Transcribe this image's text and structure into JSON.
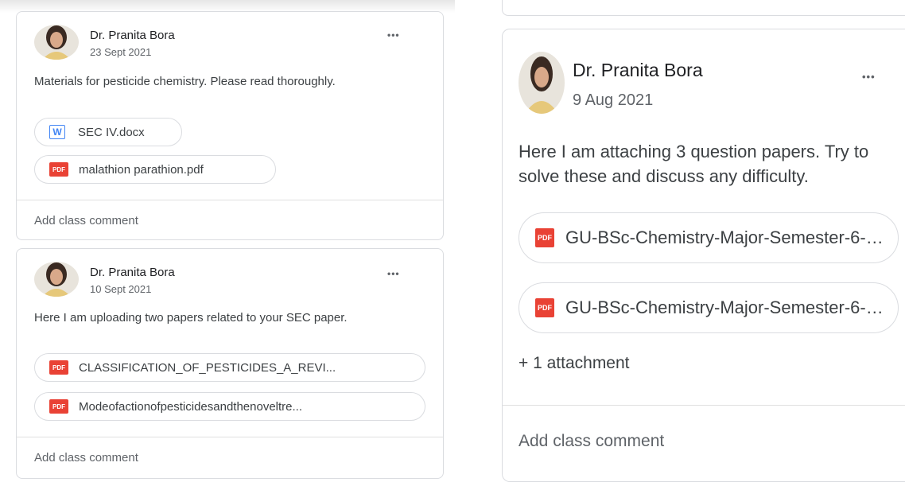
{
  "posts": [
    {
      "author": "Dr. Pranita Bora",
      "date": "23 Sept 2021",
      "message": "Materials for pesticide chemistry. Please read thoroughly.",
      "attachments": [
        {
          "type": "word",
          "icon": "W",
          "name": "SEC IV.docx"
        },
        {
          "type": "pdf",
          "icon": "PDF",
          "name": "malathion parathion.pdf"
        }
      ],
      "comment_placeholder": "Add class comment"
    },
    {
      "author": "Dr. Pranita Bora",
      "date": "10 Sept 2021",
      "message": "Here I am uploading two papers related to your SEC paper.",
      "attachments": [
        {
          "type": "pdf",
          "icon": "PDF",
          "name": "CLASSIFICATION_OF_PESTICIDES_A_REVI..."
        },
        {
          "type": "pdf",
          "icon": "PDF",
          "name": "Modeofactionofpesticidesandthenoveltre..."
        }
      ],
      "comment_placeholder": "Add class comment"
    },
    {
      "author": "Dr. Pranita Bora",
      "date": "9 Aug 2021",
      "message": "Here I am attaching 3 question papers. Try to solve these and discuss any difficulty.",
      "attachments": [
        {
          "type": "pdf",
          "icon": "PDF",
          "name": "GU-BSc-Chemistry-Major-Semester-6-P..."
        },
        {
          "type": "pdf",
          "icon": "PDF",
          "name": "GU-BSc-Chemistry-Major-Semester-6-P..."
        }
      ],
      "more_attachments": "+ 1 attachment",
      "comment_placeholder": "Add class comment"
    }
  ],
  "more_menu": "•••",
  "colors": {
    "pdf": "#e94235",
    "word": "#4285f4",
    "border": "#dadce0"
  }
}
